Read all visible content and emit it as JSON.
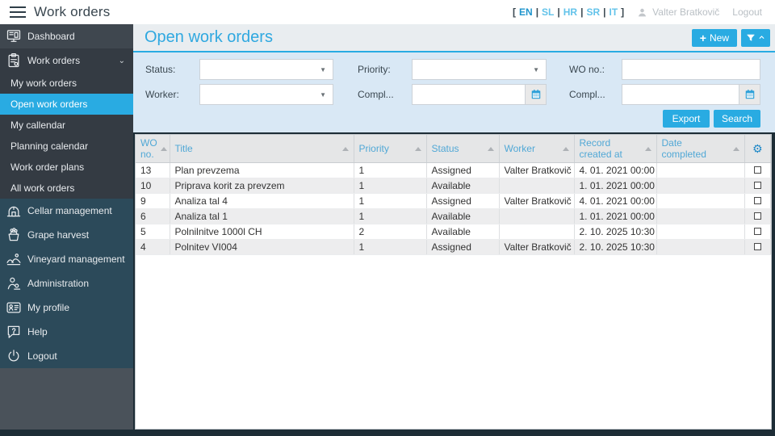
{
  "colors": {
    "accent": "#29abe2",
    "sidebar_dark": "#343b43",
    "sidebar_teal": "#2c4a5a"
  },
  "topbar": {
    "app_title": "Work orders",
    "bracket_open": "[",
    "bracket_close": "]",
    "separator": "|",
    "languages": [
      "EN",
      "SL",
      "HR",
      "SR",
      "IT"
    ],
    "active_language": "EN",
    "user_name": "Valter Bratkovič",
    "logout_label": "Logout"
  },
  "sidebar": {
    "items_top": [
      {
        "label": "Dashboard"
      },
      {
        "label": "Work orders"
      }
    ],
    "sub_items": [
      {
        "label": "My work orders"
      },
      {
        "label": "Open work orders",
        "active": true
      },
      {
        "label": "My callendar"
      },
      {
        "label": "Planning calendar"
      },
      {
        "label": "Work order plans"
      },
      {
        "label": "All work orders"
      }
    ],
    "items_lower": [
      {
        "label": "Cellar management"
      },
      {
        "label": "Grape harvest"
      },
      {
        "label": "Vineyard management"
      },
      {
        "label": "Administration"
      },
      {
        "label": "My profile"
      },
      {
        "label": "Help"
      },
      {
        "label": "Logout"
      }
    ]
  },
  "page": {
    "title": "Open work orders",
    "new_button_plus": "+",
    "new_button_label": "New"
  },
  "filters": {
    "status_label": "Status:",
    "priority_label": "Priority:",
    "wo_no_label": "WO no.:",
    "worker_label": "Worker:",
    "compl1_label": "Compl...",
    "compl2_label": "Compl...",
    "export_label": "Export",
    "search_label": "Search"
  },
  "table": {
    "columns": [
      "WO no.",
      "Title",
      "Priority",
      "Status",
      "Worker",
      "Record created at",
      "Date completed"
    ],
    "rows": [
      {
        "wo_no": "13",
        "title": "Plan prevzema",
        "priority": "1",
        "status": "Assigned",
        "worker": "Valter Bratkovič",
        "created": "4. 01. 2021 00:00",
        "completed": ""
      },
      {
        "wo_no": "10",
        "title": "Priprava korit za prevzem",
        "priority": "1",
        "status": "Available",
        "worker": "",
        "created": "1. 01. 2021 00:00",
        "completed": ""
      },
      {
        "wo_no": "9",
        "title": "Analiza tal 4",
        "priority": "1",
        "status": "Assigned",
        "worker": "Valter Bratkovič",
        "created": "4. 01. 2021 00:00",
        "completed": ""
      },
      {
        "wo_no": "6",
        "title": "Analiza tal 1",
        "priority": "1",
        "status": "Available",
        "worker": "",
        "created": "1. 01. 2021 00:00",
        "completed": ""
      },
      {
        "wo_no": "5",
        "title": "Polnilnitve 1000l CH",
        "priority": "2",
        "status": "Available",
        "worker": "",
        "created": "2. 10. 2025 10:30",
        "completed": ""
      },
      {
        "wo_no": "4",
        "title": "Polnitev VI004",
        "priority": "1",
        "status": "Assigned",
        "worker": "Valter Bratkovič",
        "created": "2. 10. 2025 10:30",
        "completed": ""
      }
    ]
  }
}
